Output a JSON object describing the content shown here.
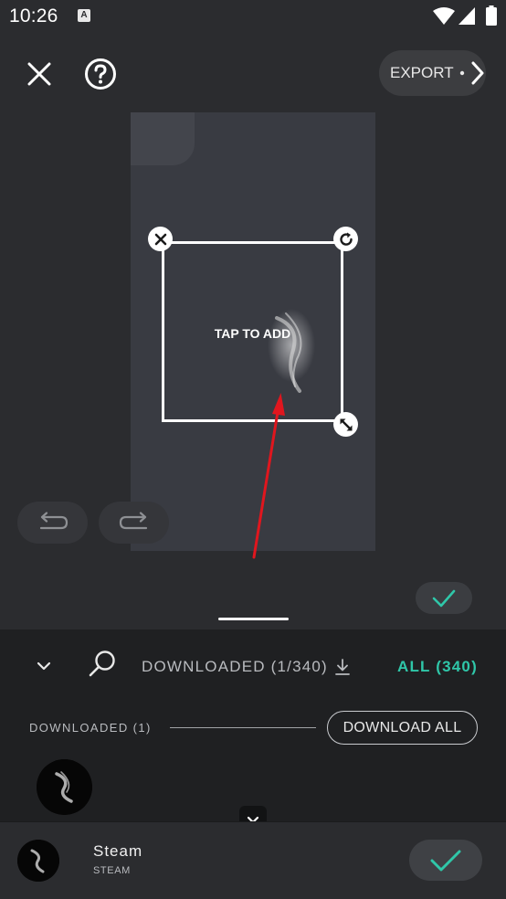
{
  "status_bar": {
    "time": "10:26",
    "app_icon_letter": "A"
  },
  "top_bar": {
    "close_icon": "close-icon",
    "help_icon": "help-icon",
    "export_label": "EXPORT",
    "export_icon": "chevron-right-icon"
  },
  "canvas": {
    "sticker_prompt": "TAP TO ADD",
    "handles": [
      "remove-icon",
      "rotate-icon",
      "resize-icon"
    ]
  },
  "history": {
    "undo_icon": "undo-icon",
    "redo_icon": "redo-icon"
  },
  "confirm_small_icon": "check-icon",
  "sheet": {
    "collapse_icon": "chevron-down-icon",
    "search_icon": "search-icon",
    "tab_downloaded": "DOWNLOADED (1/340)",
    "tab_downloaded_icon": "download-icon",
    "tab_all": "ALL (340)",
    "section_label": "DOWNLOADED (1)",
    "download_all": "DOWNLOAD ALL"
  },
  "footer": {
    "title": "Steam",
    "subtitle": "STEAM",
    "confirm_icon": "check-icon"
  },
  "colors": {
    "accent": "#2fc7a9",
    "annotation_arrow": "#e0161e"
  }
}
